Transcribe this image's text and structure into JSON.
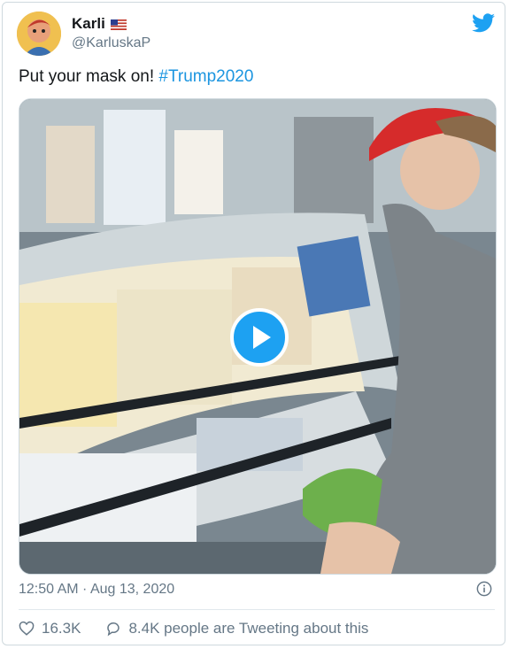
{
  "author": {
    "display_name": "Karli",
    "handle": "@KarluskaP",
    "flag_icon": "us-flag-icon",
    "avatar_icon": "avatar"
  },
  "brand": {
    "icon": "twitter-bird-icon",
    "color": "#1da1f2"
  },
  "tweet": {
    "text_prefix": "Put your mask on! ",
    "hashtag": "#Trump2020",
    "hashtag_color": "#1b95e0"
  },
  "media": {
    "type": "video",
    "play_icon": "play-icon"
  },
  "meta": {
    "timestamp": "12:50 AM · Aug 13, 2020",
    "info_icon": "info-icon"
  },
  "actions": {
    "likes": "16.3K",
    "conversation": "8.4K people are Tweeting about this"
  }
}
